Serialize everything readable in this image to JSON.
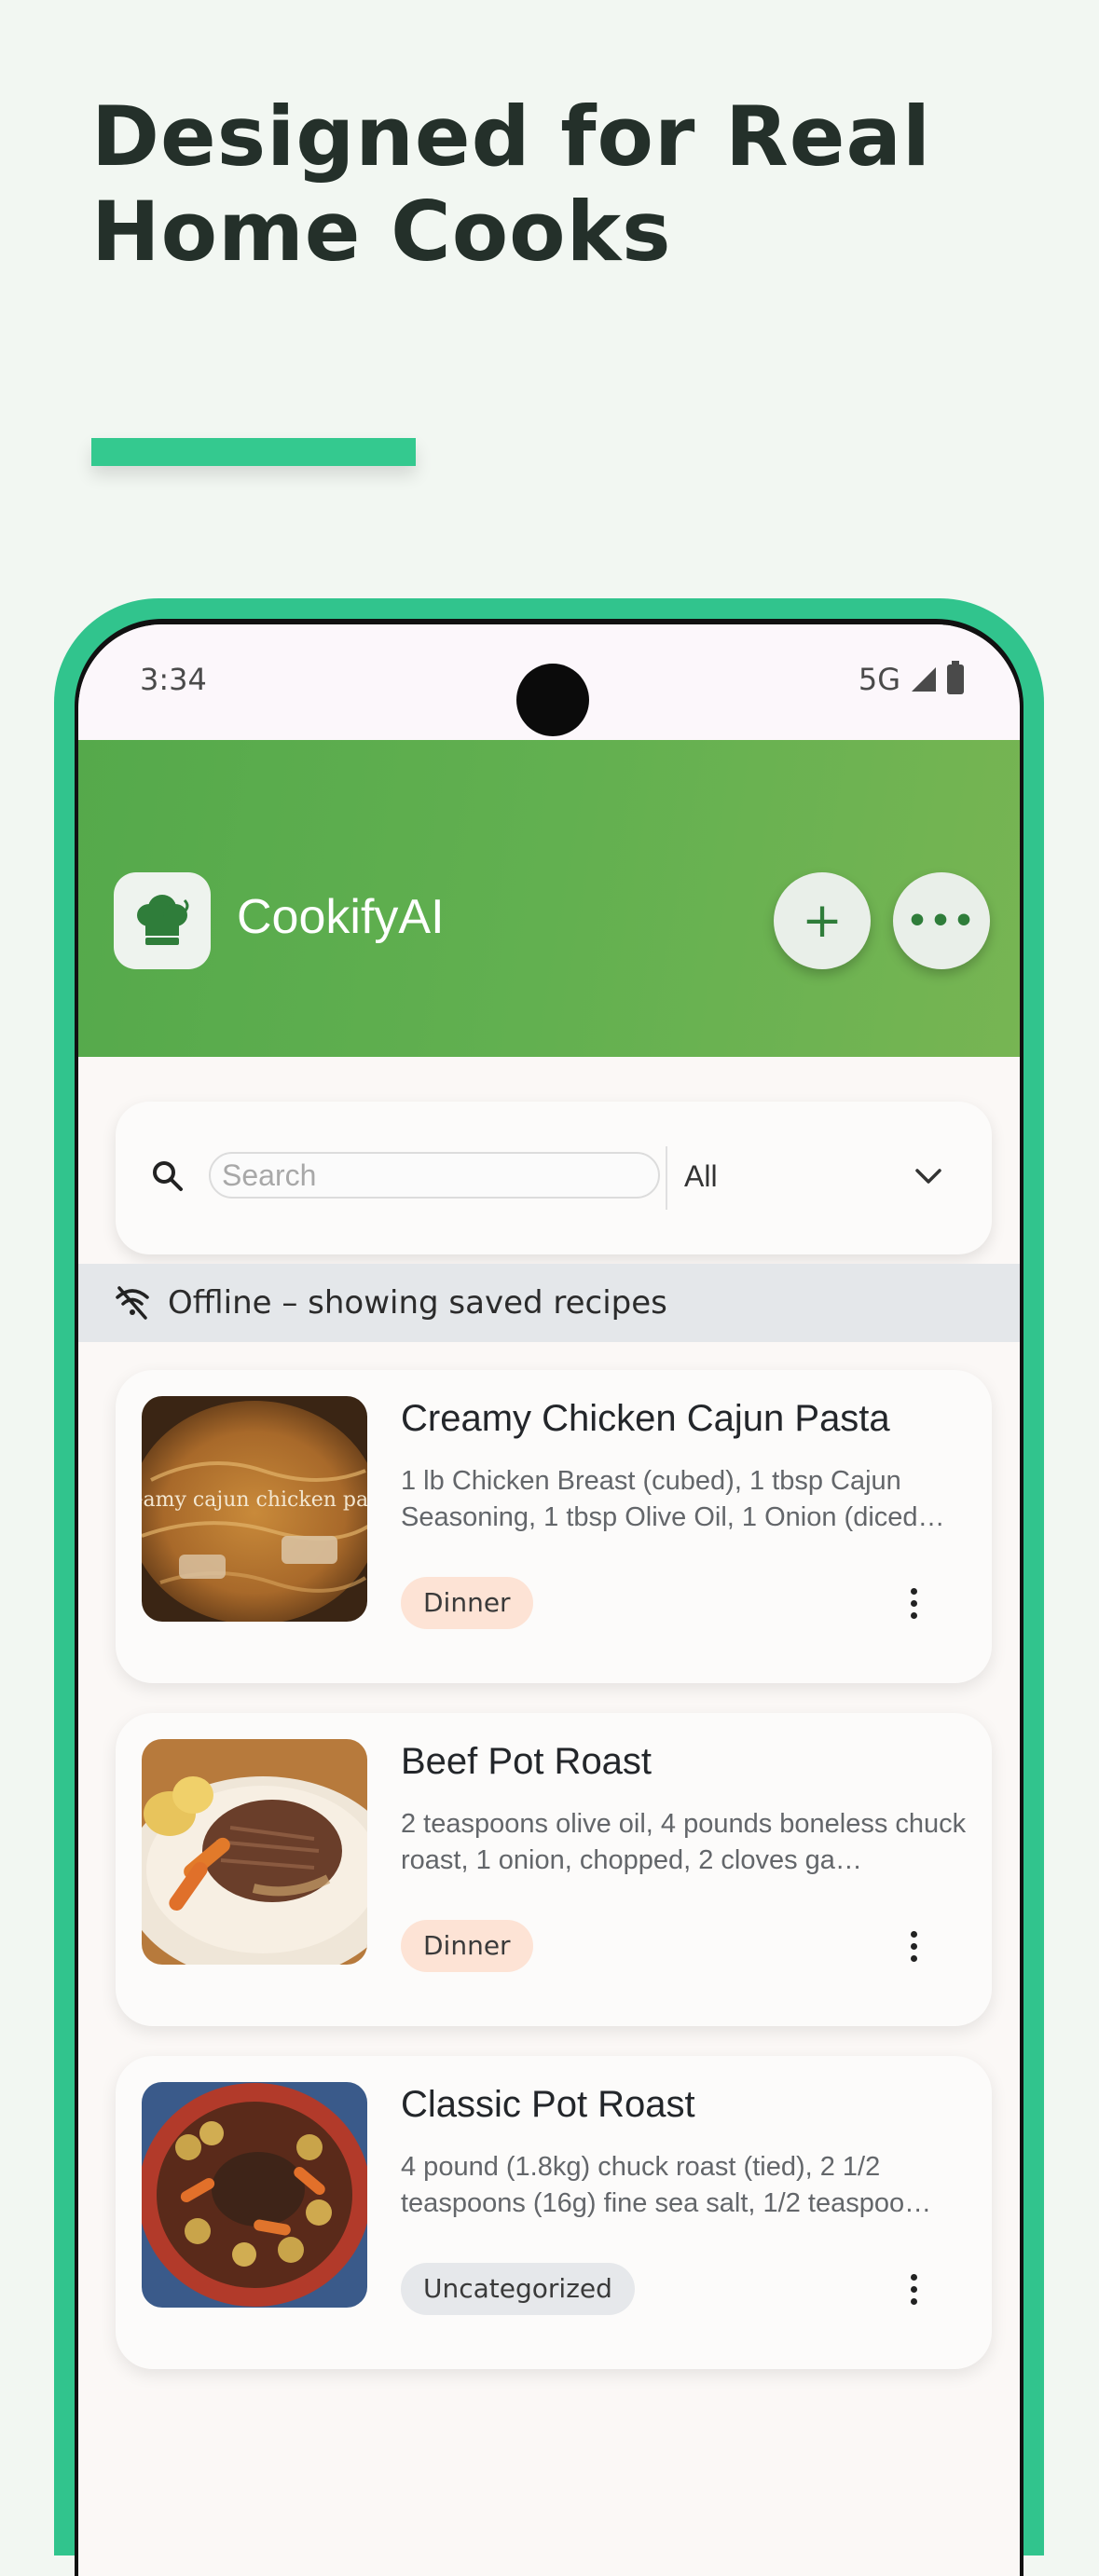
{
  "headline": {
    "line1": "Designed for Real",
    "line2": "Home Cooks"
  },
  "status_bar": {
    "time": "3:34",
    "network": "5G"
  },
  "app_bar": {
    "title": "CookifyAI",
    "add_label": "+",
    "more_label": "•••"
  },
  "search": {
    "placeholder": "Search",
    "value": "",
    "filter_value": "All"
  },
  "offline": {
    "message": "Offline – showing saved recipes"
  },
  "recipes": [
    {
      "title": "Creamy Chicken Cajun Pasta",
      "ingredients": "1 lb Chicken Breast (cubed), 1 tbsp Cajun Seasoning, 1 tbsp Olive Oil, 1 Onion (diced…",
      "category": "Dinner",
      "image_caption": "creamy cajun chicken pasta"
    },
    {
      "title": "Beef Pot Roast",
      "ingredients": "2 teaspoons olive oil, 4 pounds boneless chuck roast, 1 onion, chopped, 2 cloves ga…",
      "category": "Dinner"
    },
    {
      "title": "Classic Pot Roast",
      "ingredients": "4 pound (1.8kg) chuck roast (tied), 2 1/2 teaspoons (16g) fine sea salt, 1/2 teaspoo…",
      "category": "Uncategorized"
    }
  ],
  "colors": {
    "background": "#f2f7f2",
    "accent": "#34c98f",
    "appbar": "#62b050",
    "tag_dinner": "#fde3d5",
    "tag_uncategorized": "#e6e8eb"
  }
}
